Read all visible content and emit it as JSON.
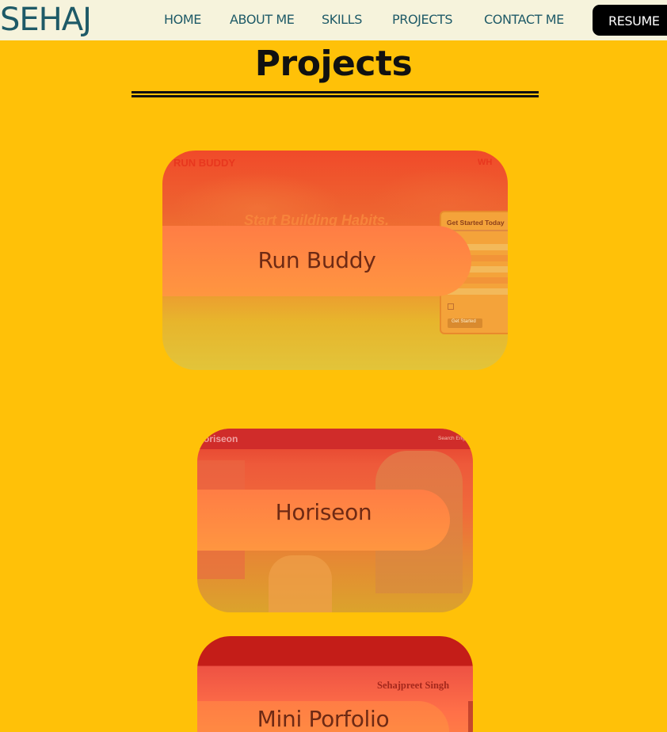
{
  "brand": "SEHAJ",
  "nav": {
    "home": "HOME",
    "about": "ABOUT ME",
    "skills": "SKILLS",
    "projects": "PROJECTS",
    "contact": "CONTACT ME",
    "resume": "RESUME"
  },
  "section_title": "Projects",
  "projects": [
    {
      "label": "Run Buddy",
      "preview": {
        "logo": "RUN BUDDY",
        "nav_partial": "WH",
        "headline": "Start Building Habits.",
        "form_title": "Get Started Today",
        "form_button": "Get Started"
      }
    },
    {
      "label": "Horiseon",
      "preview": {
        "logo": "oriseon",
        "nav_partial": "Search Engine"
      }
    },
    {
      "label": "Mini Porfolio",
      "preview": {
        "name": "Sehajpreet Singh"
      }
    }
  ],
  "colors": {
    "page_background": "#ffc108",
    "navbar_background": "#f6f3dc",
    "nav_text": "#1e5a67",
    "resume_button": "#000000",
    "label_pill": "#ff8a42"
  }
}
